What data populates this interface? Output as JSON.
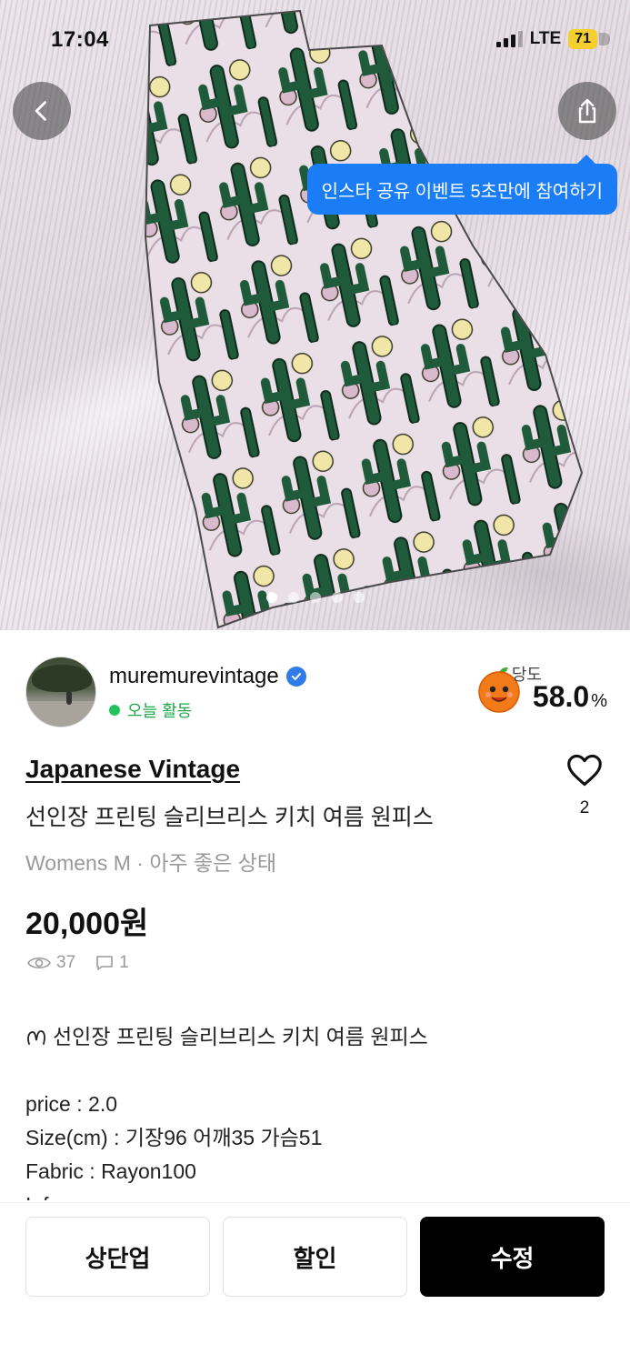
{
  "status_bar": {
    "time": "17:04",
    "network": "LTE",
    "battery": "71"
  },
  "hero": {
    "tooltip": "인스타 공유 이벤트 5초만에 참여하기",
    "image_count": 5,
    "active_index": 0
  },
  "seller": {
    "name": "muremurevintage",
    "activity": "오늘 활동",
    "manner_label": "당도",
    "manner_score": "58.0",
    "manner_unit": "%"
  },
  "product": {
    "brand": "Japanese Vintage",
    "title": "선인장 프린팅 슬리브리스 키치 여름 원피스",
    "subinfo": "Womens M · 아주 좋은 상태",
    "price": "20,000원",
    "likes": "2",
    "views": "37",
    "comments": "1"
  },
  "description": {
    "headline": "선인장 프린팅 슬리브리스 키치 여름 원피스",
    "lines": [
      "price : 2.0",
      "Size(cm) : 기장96 어깨35 가슴51",
      "Fabric : Rayon100",
      "Info :"
    ]
  },
  "actions": {
    "bump": "상단업",
    "discount": "할인",
    "edit": "수정"
  },
  "colors": {
    "tooltip": "#1a7df5",
    "active_green": "#22c35e",
    "verified": "#2f7be8",
    "primary_button": "#000000"
  }
}
